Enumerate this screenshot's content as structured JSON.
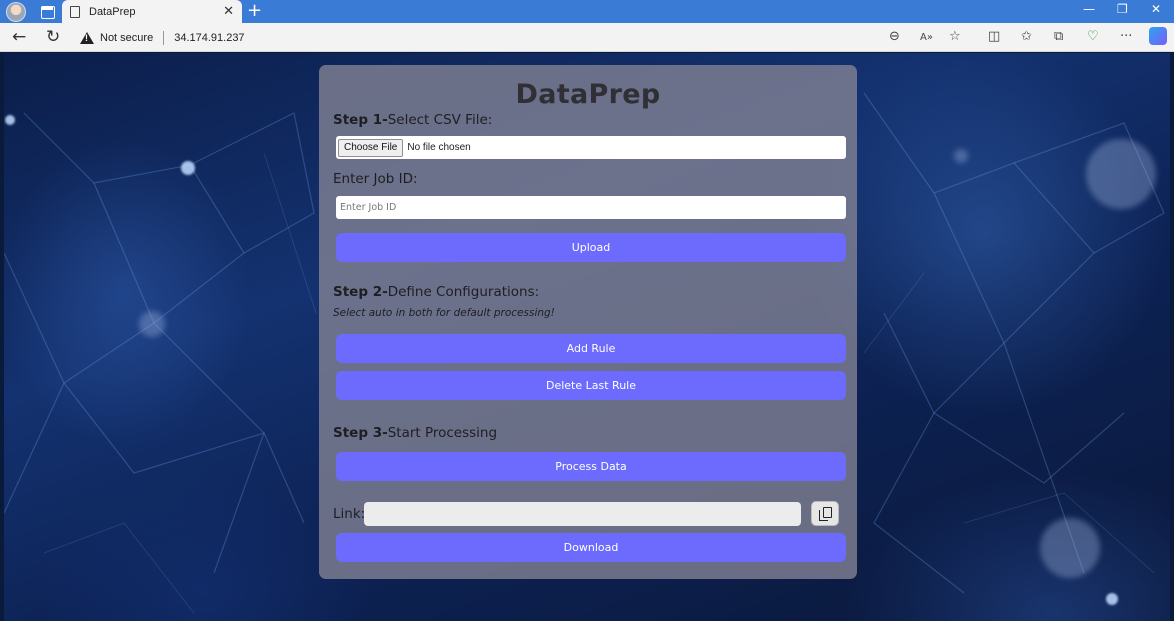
{
  "browser": {
    "tab_title": "DataPrep",
    "tab_close": "✕",
    "new_tab": "+",
    "window_controls": [
      "—",
      "❐",
      "✕"
    ],
    "security_label": "Not secure",
    "url": "34.174.91.237",
    "icons": [
      "profile-icon",
      "tab-actions-icon",
      "back-icon",
      "refresh-icon",
      "zoom-icon",
      "read-aloud-icon",
      "favorite-icon",
      "split-screen-icon",
      "favorites-icon",
      "collections-icon",
      "browser-essentials-icon",
      "more-icon",
      "copilot-icon"
    ]
  },
  "app": {
    "title": "DataPrep",
    "step1": {
      "heading_bold": "Step 1-",
      "heading_text": "Select CSV File:",
      "choose_file_label": "Choose File",
      "file_status": "No file chosen",
      "job_id_label": "Enter Job ID:",
      "job_id_placeholder": "Enter Job ID",
      "job_id_value": "",
      "upload_label": "Upload"
    },
    "step2": {
      "heading_bold": "Step 2-",
      "heading_text": "Define Configurations:",
      "hint": "Select auto in both for default processing!",
      "add_rule_label": "Add Rule",
      "delete_rule_label": "Delete Last Rule"
    },
    "step3": {
      "heading_bold": "Step 3-",
      "heading_text": "Start Processing",
      "process_label": "Process Data",
      "link_label": "Link:",
      "link_value": "",
      "download_label": "Download"
    }
  },
  "colors": {
    "accent": "#6c6bfd",
    "tabbar": "#3a7bd5",
    "card": "#82828f"
  }
}
